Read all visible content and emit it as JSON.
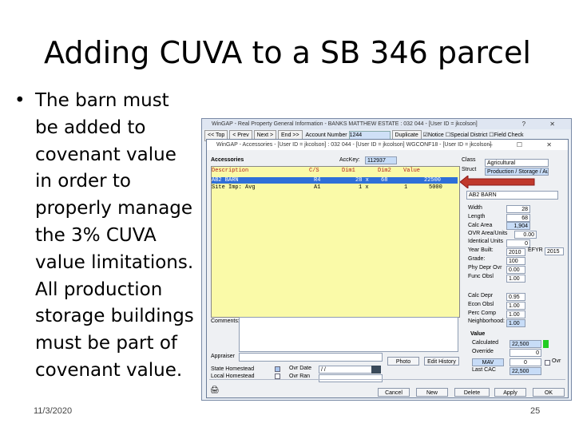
{
  "slide": {
    "title": "Adding CUVA to a SB 346 parcel",
    "bullet": "•",
    "bullet_lines": [
      "The barn must",
      "be added to",
      "covenant value",
      "in order to",
      "properly manage",
      "the 3% CUVA",
      "value limitations.",
      "All production",
      "storage buildings",
      "must be part of",
      "covenant value."
    ],
    "date": "11/3/2020",
    "page_number": "25"
  },
  "back_window": {
    "title": "WinGAP - Real Property General Information - BANKS MATTHEW ESTATE : 032  044      - [User ID = jkcolson]",
    "controls": "? ✕",
    "toolbar": {
      "top": "<< Top",
      "prev": "< Prev",
      "next": "Next >",
      "end": "End >>",
      "account_label": "Account Number",
      "account_value": "1244",
      "duplicate": "Duplicate",
      "notice": "Notice",
      "special_district": "Special District",
      "field_check": "Field Check"
    }
  },
  "window": {
    "title": "WinGAP - Accessories - [User ID = jkcolson] : 032  044      - [User ID = jkcolson] WGCONF18 - [User ID = jkcolson]",
    "controls": "– ☐ ✕",
    "accessories_label": "Accessories",
    "acckey_label": "AccKey:",
    "acckey_value": "112937",
    "columns": [
      "Description",
      "C/S",
      "Dim1",
      "Dim2",
      "Value"
    ],
    "rows": [
      {
        "description": "AB2 BARN",
        "cs": "R4",
        "dim1": "28 x",
        "dim2": "68",
        "value": "22500",
        "selected": true
      },
      {
        "description": "Site Imp: Avg",
        "cs": "A1",
        "dim1": "1 x",
        "dim2": "1",
        "value": "5000",
        "selected": false
      }
    ],
    "class_label": "Class",
    "class_value": "Agricultural",
    "struct_label": "Struct",
    "struct_value": "Production / Storage / Aux",
    "code_value": "AB2 BARN",
    "width_label": "Width",
    "width_value": "28",
    "length_label": "Length",
    "length_value": "68",
    "calc_area_label": "Calc Area",
    "calc_area_value": "1,904",
    "ovr_area_label": "OVR Area/Units",
    "ovr_area_value": "0.00",
    "identical_units_label": "Identical Units",
    "identical_units_value": "0",
    "year_built_label": "Year Built:",
    "year_built_value": "2010",
    "efyr_label": "EFYR",
    "efyr_value": "2015",
    "grade_label": "Grade:",
    "grade_value": "100",
    "phy_depr_label": "Phy Depr Ovr",
    "phy_depr_value": "0.00",
    "func_obsl_label": "Func Obsl",
    "func_obsl_value": "1.00",
    "calc_depr_label": "Calc Depr",
    "calc_depr_value": "0.95",
    "econ_obsl_label": "Econ Obsl",
    "econ_obsl_value": "1.00",
    "perc_comp_label": "Perc Comp",
    "perc_comp_value": "1.00",
    "neighborhood_label": "Neighborhood:",
    "neighborhood_value": "1.00",
    "value_label": "Value",
    "calculated_label": "Calculated",
    "calculated_value": "22,500",
    "override_label": "Override",
    "override_value": "0",
    "mav_label": "MAV",
    "mav_value": "0",
    "last_cac_label": "Last CAC",
    "last_cac_value": "22,500",
    "ovr_label": "Ovr",
    "comments_label": "Comments:",
    "appraiser_label": "Appraiser",
    "state_homestead_label": "State Homestead",
    "local_homestead_label": "Local Homestead",
    "ovr_date_label": "Ovr Date",
    "ovr_date_value": "/ /",
    "ovr_ran_label": "Ovr Ran",
    "photo_label": "Photo",
    "edit_history_label": "Edit History",
    "cancel_label": "Cancel",
    "new_label": "New",
    "delete_label": "Delete",
    "apply_label": "Apply",
    "ok_label": "OK"
  },
  "colors": {
    "grid_yellow": "#fafaa8",
    "selected_row": "#2f6fd8",
    "arrow_red": "#c0392b",
    "green_flag": "#22cc22"
  }
}
